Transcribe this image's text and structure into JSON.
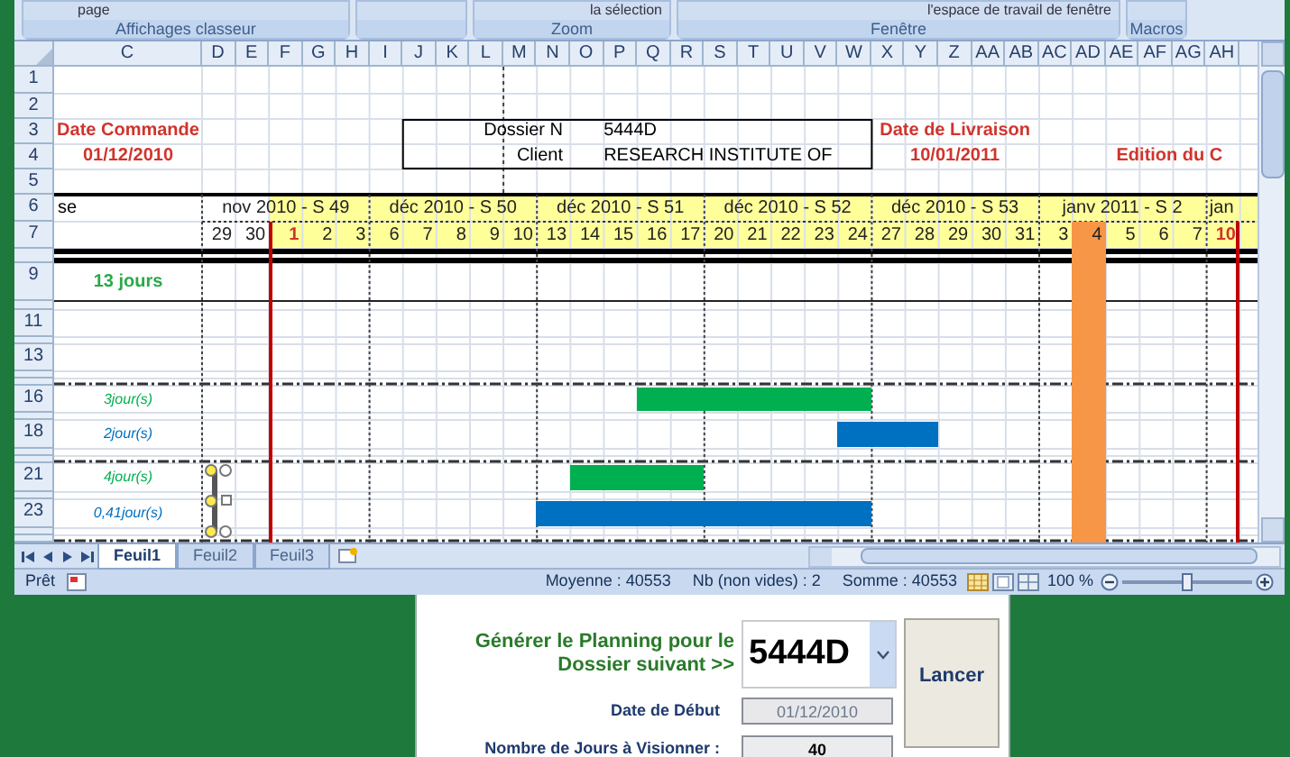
{
  "ribbon": {
    "top_texts": [
      "page",
      "la sélection",
      "l'espace de travail  de fenêtre"
    ],
    "groups": [
      "Affichages classeur",
      "Zoom",
      "Fenêtre",
      "Macros"
    ]
  },
  "sheet": {
    "column_headers": [
      "C",
      "D",
      "E",
      "F",
      "G",
      "H",
      "I",
      "J",
      "K",
      "L",
      "M",
      "N",
      "O",
      "P",
      "Q",
      "R",
      "S",
      "T",
      "U",
      "V",
      "W",
      "X",
      "Y",
      "Z",
      "AA",
      "AB",
      "AC",
      "AD",
      "AE",
      "AF",
      "AG",
      "AH"
    ],
    "row_numbers": [
      "1",
      "2",
      "3",
      "4",
      "5",
      "6",
      "7",
      "9",
      "11",
      "13",
      "16",
      "18",
      "21",
      "23"
    ],
    "order": {
      "label": "Date Commande",
      "date": "01/12/2010"
    },
    "dossier": {
      "number_label": "Dossier N",
      "number": "5444D",
      "client_label": "Client",
      "client": "RESEARCH INSTITUTE OF"
    },
    "delivery": {
      "label": "Date de Livraison",
      "date": "10/01/2011"
    },
    "edition_label": "Edition du C",
    "row6_label": "se",
    "weeks": [
      {
        "label": "nov 2010 - S 49"
      },
      {
        "label": "déc 2010 - S 50"
      },
      {
        "label": "déc 2010 - S 51"
      },
      {
        "label": "déc 2010 - S 52"
      },
      {
        "label": "déc 2010 - S 53"
      },
      {
        "label": "janv 2011 - S 2"
      },
      {
        "label": "jan"
      }
    ],
    "days": [
      {
        "label": "29",
        "marked": false,
        "highlighted": false
      },
      {
        "label": "30",
        "marked": false,
        "highlighted": false
      },
      {
        "label": "1",
        "marked": true,
        "highlighted": false
      },
      {
        "label": "2",
        "marked": false,
        "highlighted": false
      },
      {
        "label": "3",
        "marked": false,
        "highlighted": false
      },
      {
        "label": "6",
        "marked": false,
        "highlighted": false
      },
      {
        "label": "7",
        "marked": false,
        "highlighted": false
      },
      {
        "label": "8",
        "marked": false,
        "highlighted": false
      },
      {
        "label": "9",
        "marked": false,
        "highlighted": false
      },
      {
        "label": "10",
        "marked": false,
        "highlighted": false
      },
      {
        "label": "13",
        "marked": false,
        "highlighted": false
      },
      {
        "label": "14",
        "marked": false,
        "highlighted": false
      },
      {
        "label": "15",
        "marked": false,
        "highlighted": false
      },
      {
        "label": "16",
        "marked": false,
        "highlighted": false
      },
      {
        "label": "17",
        "marked": false,
        "highlighted": false
      },
      {
        "label": "20",
        "marked": false,
        "highlighted": false
      },
      {
        "label": "21",
        "marked": false,
        "highlighted": false
      },
      {
        "label": "22",
        "marked": false,
        "highlighted": false
      },
      {
        "label": "23",
        "marked": false,
        "highlighted": false
      },
      {
        "label": "24",
        "marked": false,
        "highlighted": false
      },
      {
        "label": "27",
        "marked": false,
        "highlighted": false
      },
      {
        "label": "28",
        "marked": false,
        "highlighted": false
      },
      {
        "label": "29",
        "marked": false,
        "highlighted": false
      },
      {
        "label": "30",
        "marked": false,
        "highlighted": false
      },
      {
        "label": "31",
        "marked": false,
        "highlighted": false
      },
      {
        "label": "3",
        "marked": false,
        "highlighted": false
      },
      {
        "label": "4",
        "marked": false,
        "highlighted": true
      },
      {
        "label": "5",
        "marked": false,
        "highlighted": false
      },
      {
        "label": "6",
        "marked": false,
        "highlighted": false
      },
      {
        "label": "7",
        "marked": false,
        "highlighted": false
      },
      {
        "label": "10",
        "marked": true,
        "highlighted": false
      }
    ],
    "total": "13 jours",
    "tasks": [
      {
        "duration": "3jour(s)",
        "color": "#00b050"
      },
      {
        "duration": "2jour(s)",
        "color": "#0070c0"
      },
      {
        "duration": "4jour(s)",
        "color": "#00b050"
      },
      {
        "duration": "0,41jour(s)",
        "color": "#0070c0"
      }
    ]
  },
  "sheet_tabs": [
    {
      "label": "Feuil1",
      "selected": true
    },
    {
      "label": "Feuil2",
      "selected": false
    },
    {
      "label": "Feuil3",
      "selected": false
    }
  ],
  "status_bar": {
    "ready": "Prêt",
    "average": "Moyenne : 40553",
    "count": "Nb (non vides) : 2",
    "sum": "Somme : 40553",
    "zoom": "100 %",
    "zoom_slider": {
      "level": 0.5
    }
  },
  "form": {
    "prompt": "Générer le Planning pour le Dossier suivant >>",
    "dossier": "5444D",
    "start_label": "Date de Début",
    "start_value": "01/12/2010",
    "days_label": "Nombre de Jours à Visionner :",
    "days_value": "40",
    "button": "Lancer"
  }
}
